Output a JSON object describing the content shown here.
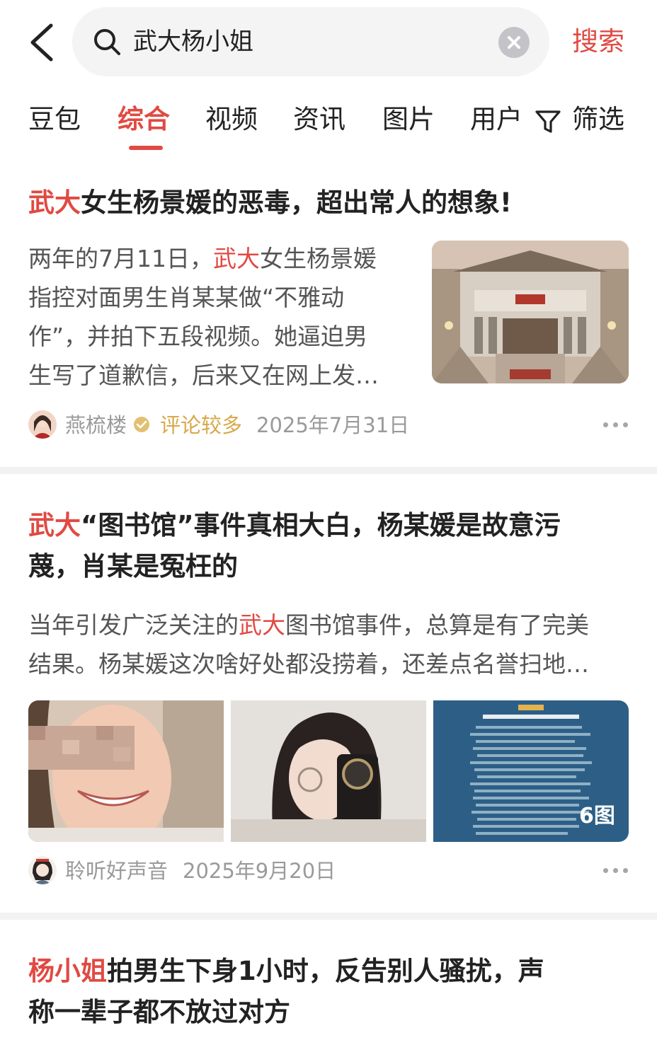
{
  "search": {
    "query": "武大杨小姐",
    "action_label": "搜索"
  },
  "tabs": [
    {
      "label": "豆包"
    },
    {
      "label": "综合"
    },
    {
      "label": "视频"
    },
    {
      "label": "资讯"
    },
    {
      "label": "图片"
    },
    {
      "label": "用户"
    }
  ],
  "filter_label": "筛选",
  "colors": {
    "accent": "#e04a42",
    "badge_gold": "#d8a84a",
    "text_main": "#222222",
    "text_meta": "#9a9a9a"
  },
  "results": [
    {
      "title_highlight": "武大",
      "title_rest": "女生杨景媛的恶毒，超出常人的想象!",
      "abstract": {
        "l1_a": "两年的7月11日，",
        "l1_hl": "武大",
        "l1_b": "女生杨景媛",
        "l2": "指控对面男生肖某某做“不雅动",
        "l3": "作”，并拍下五段视频。她逼迫男",
        "l4": "生写了道歉信，后来又在网上发…"
      },
      "author": "燕梳楼",
      "badge": "评论较多",
      "date": "2025年7月31日"
    },
    {
      "title_highlight": "武大",
      "title_rest_l1": "“图书馆”事件真相大白，杨某媛是故意污",
      "title_l2": "蔑，肖某是冤枉的",
      "abstract": {
        "l1_a": "当年引发广泛关注的",
        "l1_hl": "武大",
        "l1_b": "图书馆事件，总算是有了完美",
        "l2": "结果。杨某媛这次啥好处都没捞着，还差点名誉扫地…"
      },
      "image_count": "6图",
      "author": "聆听好声音",
      "date": "2025年9月20日"
    },
    {
      "title_highlight": "杨小姐",
      "title_rest_l1": "拍男生下身1小时，反告别人骚扰，声",
      "title_l2": "称一辈子都不放过对方"
    }
  ]
}
